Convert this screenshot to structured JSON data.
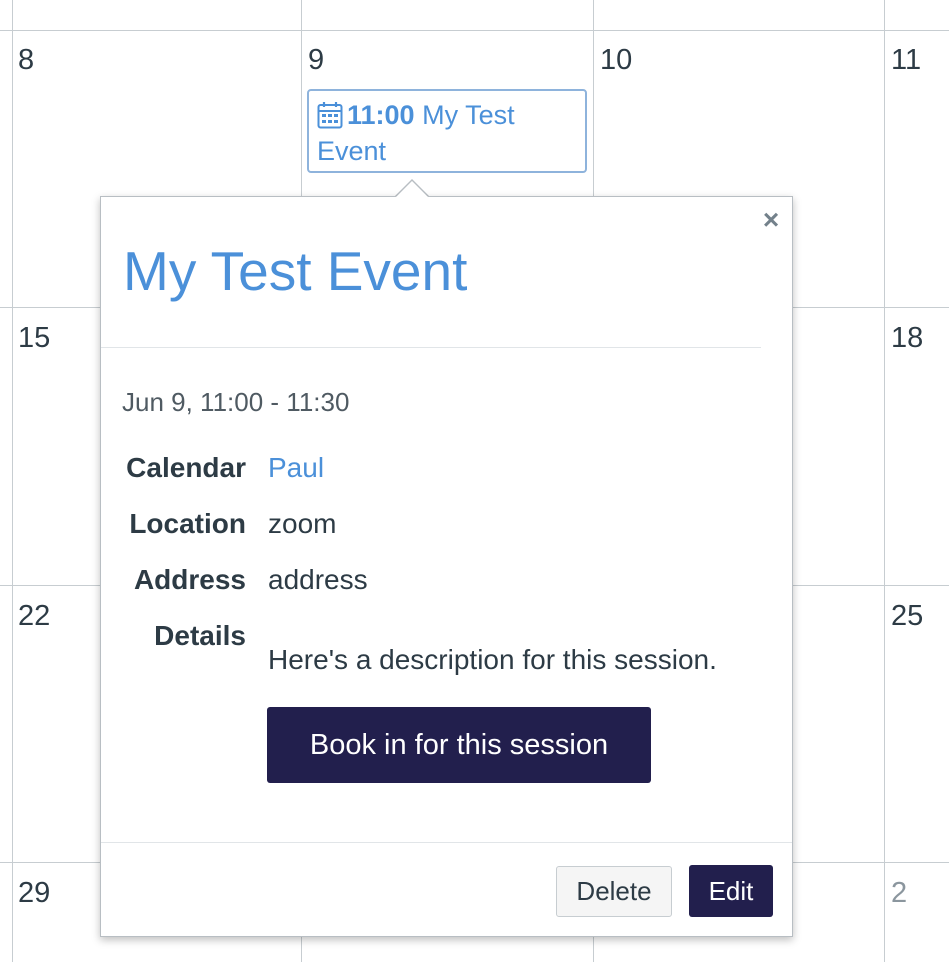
{
  "calendar": {
    "days": [
      {
        "id": "d8",
        "label": "8"
      },
      {
        "id": "d9",
        "label": "9"
      },
      {
        "id": "d10",
        "label": "10"
      },
      {
        "id": "d11",
        "label": "11"
      },
      {
        "id": "d15",
        "label": "15"
      },
      {
        "id": "d18",
        "label": "18"
      },
      {
        "id": "d22",
        "label": "22"
      },
      {
        "id": "d25",
        "label": "25"
      },
      {
        "id": "d29",
        "label": "29"
      },
      {
        "id": "d2",
        "label": "2"
      }
    ],
    "event_chip": {
      "icon": "calendar-icon",
      "time": "11:00",
      "title": "My Test Event"
    }
  },
  "popover": {
    "title": "My Test Event",
    "date_range": "Jun 9, 11:00 - 11:30",
    "details": [
      {
        "label": "Calendar",
        "value": "Paul"
      },
      {
        "label": "Location",
        "value": "zoom"
      },
      {
        "label": "Address",
        "value": "address"
      },
      {
        "label": "Details",
        "value": "Here's a description for this session."
      }
    ],
    "book_button": "Book in for this session",
    "close_glyph": "×",
    "delete_button": "Delete",
    "edit_button": "Edit"
  },
  "colors": {
    "link": "#4b90d9",
    "primary_button": "#221f4d",
    "text": "#2d3b45"
  }
}
